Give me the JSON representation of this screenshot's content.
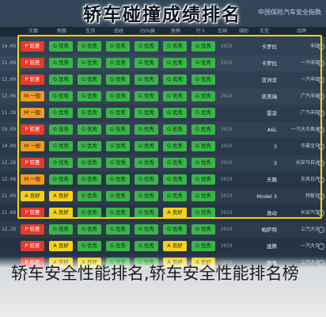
{
  "title": "轿车碰撞成绩排名",
  "corner_note": "中国保险汽车安全指数",
  "headers": [
    "",
    "正面",
    "侧面",
    "车顶",
    "后碰",
    "25%偏",
    "座椅",
    "行人",
    "车辆",
    "辅助",
    "",
    "车型",
    "品牌"
  ],
  "rows": [
    {
      "side": "14.09",
      "badge": {
        "text": "P 较差",
        "kind": "poor"
      },
      "cells": [
        "G 优秀",
        "G 优秀",
        "G 优秀",
        "G 优秀",
        "G 优秀",
        "G 优秀",
        "G 优秀"
      ],
      "year": "2018",
      "car": "卡罗拉",
      "brand": "丰田"
    },
    {
      "side": "11.08",
      "badge": {
        "text": "P 较差",
        "kind": "poor"
      },
      "cells": [
        "G 优秀",
        "G 优秀",
        "G 优秀",
        "G 优秀",
        "G 优秀",
        "G 优秀",
        "G 优秀"
      ],
      "year": "2019",
      "car": "卡罗拉",
      "brand": "一汽丰田"
    },
    {
      "side": "12.09",
      "badge": {
        "text": "P 较差",
        "kind": "poor"
      },
      "cells": [
        "G 优秀",
        "G 优秀",
        "G 优秀",
        "G 优秀",
        "G 优秀",
        "G 优秀",
        "G 优秀"
      ],
      "year": "",
      "car": "亚洲龙",
      "brand": "一汽丰田"
    },
    {
      "side": "12.06",
      "badge": {
        "text": "M 一般",
        "kind": "mid"
      },
      "cells": [
        "G 优秀",
        "G 优秀",
        "G 优秀",
        "G 优秀",
        "G 优秀",
        "G 优秀",
        "G 优秀"
      ],
      "year": "2018",
      "car": "凯美瑞",
      "brand": "广汽丰田"
    },
    {
      "side": "11.28",
      "badge": {
        "text": "M 一般",
        "kind": "mid"
      },
      "cells": [
        "G 优秀",
        "G 优秀",
        "G 优秀",
        "G 优秀",
        "G 优秀",
        "G 优秀",
        "G 优秀"
      ],
      "year": "",
      "car": "雷凌",
      "brand": "广汽丰田"
    },
    {
      "side": "10.09",
      "badge": {
        "text": "P 较差",
        "kind": "poor"
      },
      "cells": [
        "G 优秀",
        "G 优秀",
        "G 优秀",
        "G 优秀",
        "G 优秀",
        "G 优秀",
        "G 优秀"
      ],
      "year": "2019",
      "car": "A6L",
      "brand": "一汽大众奥迪"
    },
    {
      "side": "10.08",
      "badge": {
        "text": "M 一般",
        "kind": "mid"
      },
      "cells": [
        "G 优秀",
        "G 优秀",
        "G 优秀",
        "G 优秀",
        "G 优秀",
        "G 优秀",
        "G 优秀"
      ],
      "year": "2018",
      "car": "3",
      "brand": "华晨宝马"
    },
    {
      "side": "12.28",
      "badge": {
        "text": "P 较差",
        "kind": "poor"
      },
      "cells": [
        "G 优秀",
        "G 优秀",
        "G 优秀",
        "G 优秀",
        "G 优秀",
        "G 优秀",
        "G 优秀"
      ],
      "year": "2020",
      "car": "3",
      "brand": "长安马自达"
    },
    {
      "side": "12.08",
      "badge": {
        "text": "M 一般",
        "kind": "mid"
      },
      "cells": [
        "G 优秀",
        "G 优秀",
        "G 优秀",
        "G 优秀",
        "G 优秀",
        "G 优秀",
        "G 优秀"
      ],
      "year": "2019",
      "car": "天籁",
      "brand": "东风日产"
    },
    {
      "side": "11.09",
      "badge": {
        "text": "A 良好",
        "kind": "good"
      },
      "cells": [
        "A 良好",
        "G 优秀",
        "G 优秀",
        "G 优秀",
        "G 优秀",
        "G 优秀",
        "G 优秀"
      ],
      "year": "2019",
      "car": "Model 3",
      "brand": "特斯拉"
    },
    {
      "side": "11.08",
      "badge": {
        "text": "P 较差",
        "kind": "poor"
      },
      "cells": [
        "A 良好",
        "G 优秀",
        "G 优秀",
        "G 优秀",
        "A 良好",
        "G 优秀",
        "G 优秀"
      ],
      "year": "2019",
      "car": "逸动",
      "brand": "长安汽车"
    },
    {
      "side": "12.29",
      "badge": {
        "text": "P 较差",
        "kind": "poor"
      },
      "cells": [
        "G 优秀",
        "G 优秀",
        "G 优秀",
        "G 优秀",
        "G 优秀",
        "G 优秀",
        "G 优秀"
      ],
      "year": "2019",
      "car": "帕萨特",
      "brand": "上汽大众"
    },
    {
      "side": "",
      "badge": {
        "text": "P 较差",
        "kind": "poor"
      },
      "cells": [
        "A 良好",
        "G 优秀",
        "G 优秀",
        "G 优秀",
        "A 良好",
        "G 优秀",
        "G 优秀"
      ],
      "year": "2019",
      "car": "速腾",
      "brand": "一汽大众"
    },
    {
      "side": "",
      "badge": {
        "text": "P 较差",
        "kind": "poor"
      },
      "cells": [
        "A 良好",
        "A 良好",
        "G 优秀",
        "G 优秀",
        "A 良好",
        "A 良好",
        "G 优秀"
      ],
      "year": "2019",
      "car": "朗逸",
      "brand": "上汽大众"
    }
  ],
  "watermark": "轿车安全性能排名,轿车安全性能排名榜"
}
